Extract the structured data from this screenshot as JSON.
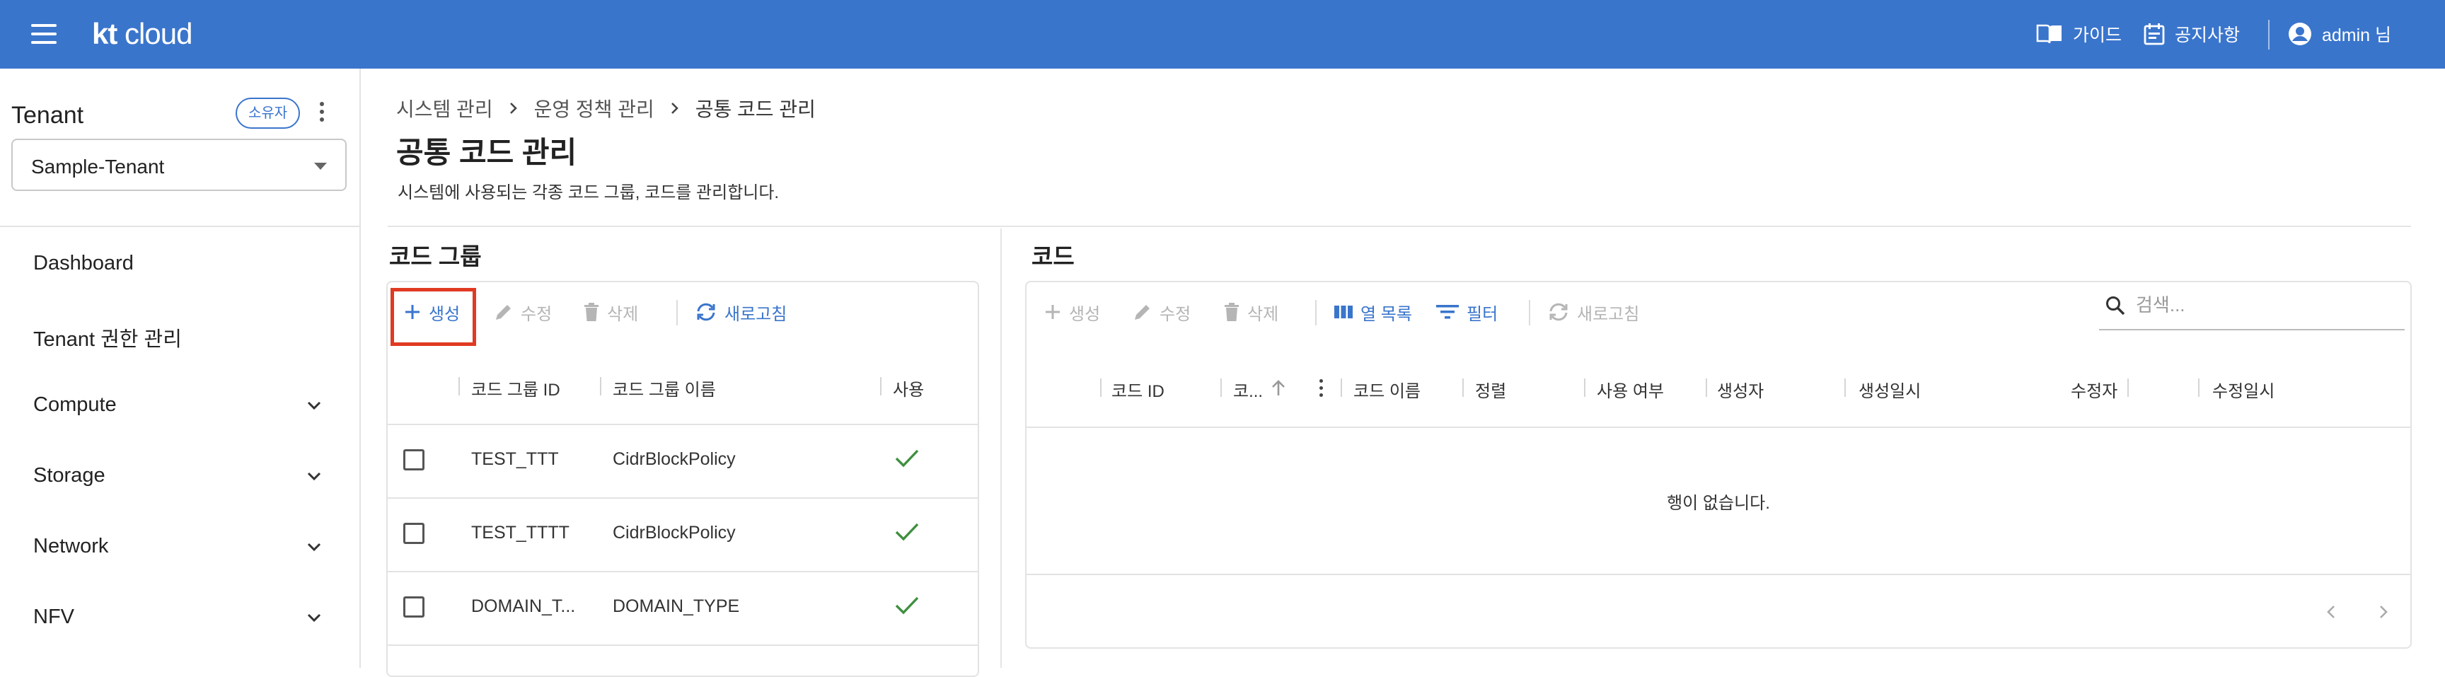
{
  "app": {
    "logo_kt": "kt",
    "logo_cloud": "cloud",
    "guide_label": "가이드",
    "notice_label": "공지사항",
    "user_label": "admin 님"
  },
  "sidebar": {
    "tenant_title": "Tenant",
    "owner_badge": "소유자",
    "tenant_value": "Sample-Tenant",
    "items": [
      {
        "label": "Dashboard",
        "expandable": false
      },
      {
        "label": "Tenant 권한 관리",
        "expandable": false
      },
      {
        "label": "Compute",
        "expandable": true
      },
      {
        "label": "Storage",
        "expandable": true
      },
      {
        "label": "Network",
        "expandable": true
      },
      {
        "label": "NFV",
        "expandable": true
      }
    ]
  },
  "page": {
    "breadcrumb": [
      "시스템 관리",
      "운영 정책 관리",
      "공통 코드 관리"
    ],
    "title": "공통 코드 관리",
    "description": "시스템에 사용되는 각종 코드 그룹, 코드를 관리합니다."
  },
  "code_group": {
    "title": "코드 그룹",
    "toolbar": {
      "create": "생성",
      "edit": "수정",
      "delete": "삭제",
      "refresh": "새로고침"
    },
    "columns": [
      "코드 그룹 ID",
      "코드 그룹 이름",
      "사용"
    ],
    "rows": [
      {
        "id": "TEST_TTT",
        "name": "CidrBlockPolicy",
        "used": true
      },
      {
        "id": "TEST_TTTT",
        "name": "CidrBlockPolicy",
        "used": true
      },
      {
        "id": "DOMAIN_T...",
        "name": "DOMAIN_TYPE",
        "used": true
      }
    ]
  },
  "code": {
    "title": "코드",
    "toolbar": {
      "create": "생성",
      "edit": "수정",
      "delete": "삭제",
      "columns": "열 목록",
      "filter": "필터",
      "refresh": "새로고침"
    },
    "search_placeholder": "검색...",
    "columns": [
      "코드 ID",
      "코...",
      "코드 이름",
      "정렬",
      "사용 여부",
      "생성자",
      "생성일시",
      "수정자",
      "수정일시"
    ],
    "empty_text": "행이 없습니다."
  },
  "colors": {
    "primary": "#3a75cc",
    "highlight": "#e03a22",
    "check": "#3f8f3f"
  },
  "icons": {
    "top": [
      "menu-icon",
      "book-icon",
      "calendar-icon",
      "account-icon"
    ],
    "toolbar": [
      "plus-icon",
      "pencil-icon",
      "trash-icon",
      "refresh-icon",
      "columns-icon",
      "filter-icon"
    ]
  }
}
